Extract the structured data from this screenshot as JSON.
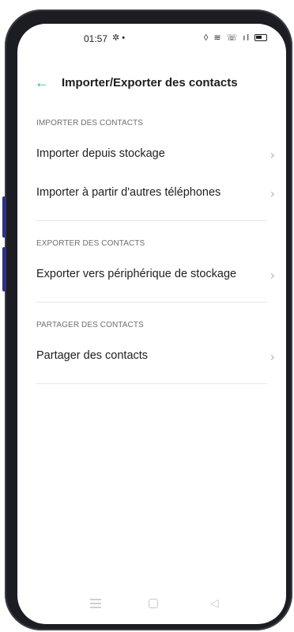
{
  "status": {
    "time": "01:57",
    "left_icons": "✲ •",
    "right_icons": "◊ ≋ ☏ ıl"
  },
  "header": {
    "title": "Importer/Exporter des contacts"
  },
  "sections": [
    {
      "label": "IMPORTER DES CONTACTS",
      "items": [
        {
          "label": "Importer depuis stockage"
        },
        {
          "label": "Importer à partir d'autres téléphones"
        }
      ]
    },
    {
      "label": "EXPORTER DES CONTACTS",
      "items": [
        {
          "label": "Exporter vers périphérique de stockage"
        }
      ]
    },
    {
      "label": "PARTAGER DES CONTACTS",
      "items": [
        {
          "label": "Partager des contacts"
        }
      ]
    }
  ],
  "icons": {
    "back": "arrow-left-icon",
    "chevron": "chevron-right-icon",
    "nav_menu": "menu-icon",
    "nav_home": "home-icon",
    "nav_back": "back-triangle-icon"
  },
  "colors": {
    "accent": "#2bb673",
    "frame": "#1c1d22",
    "side_button": "#2b2f8c"
  }
}
